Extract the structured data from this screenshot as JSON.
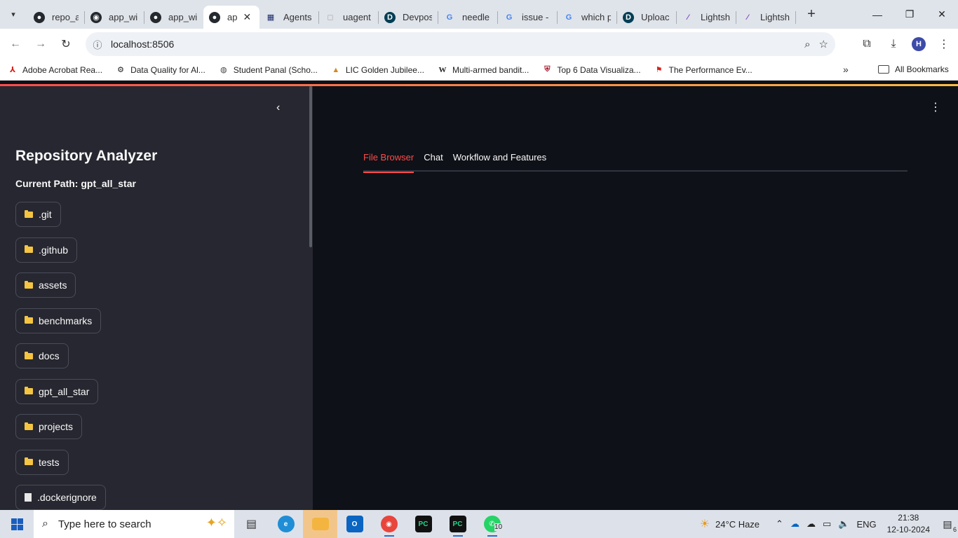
{
  "browser": {
    "tabs": [
      {
        "title": "repo_ar",
        "icon": "github-icon"
      },
      {
        "title": "app_wi",
        "icon": "streamlit-icon"
      },
      {
        "title": "app_wi",
        "icon": "github-icon"
      },
      {
        "title": "ap",
        "icon": "github-icon",
        "active": true
      },
      {
        "title": "Agents",
        "icon": "grid-app-icon"
      },
      {
        "title": "uagent",
        "icon": "cube-icon"
      },
      {
        "title": "Devpos",
        "icon": "devpost-icon"
      },
      {
        "title": "needle",
        "icon": "google-icon"
      },
      {
        "title": "issue -",
        "icon": "google-icon"
      },
      {
        "title": "which p",
        "icon": "google-icon"
      },
      {
        "title": "Uploac",
        "icon": "devpost-icon"
      },
      {
        "title": "Lightsh",
        "icon": "lightning-icon"
      },
      {
        "title": "Lightsh",
        "icon": "lightning-icon"
      }
    ],
    "url": "localhost:8506",
    "avatar_letter": "H",
    "bookmarks": [
      {
        "label": "Adobe Acrobat Rea...",
        "icon": "acrobat-icon"
      },
      {
        "label": "Data Quality for Al...",
        "icon": "data-quality-icon"
      },
      {
        "label": "Student Panal (Scho...",
        "icon": "globe-icon"
      },
      {
        "label": "LIC Golden Jubilee...",
        "icon": "graduation-icon"
      },
      {
        "label": "Multi-armed bandit...",
        "icon": "wikipedia-icon"
      },
      {
        "label": "Top 6 Data Visualiza...",
        "icon": "harvard-icon"
      },
      {
        "label": "The Performance Ev...",
        "icon": "red-bookmark-icon"
      }
    ],
    "all_bookmarks_label": "All Bookmarks"
  },
  "app": {
    "sidebar": {
      "title": "Repository Analyzer",
      "current_path": "Current Path: gpt_all_star",
      "items": [
        {
          "label": ".git",
          "type": "folder"
        },
        {
          "label": ".github",
          "type": "folder"
        },
        {
          "label": "assets",
          "type": "folder"
        },
        {
          "label": "benchmarks",
          "type": "folder"
        },
        {
          "label": "docs",
          "type": "folder"
        },
        {
          "label": "gpt_all_star",
          "type": "folder"
        },
        {
          "label": "projects",
          "type": "folder"
        },
        {
          "label": "tests",
          "type": "folder"
        },
        {
          "label": ".dockerignore",
          "type": "file"
        }
      ]
    },
    "tabs": [
      {
        "label": "File Browser",
        "active": true
      },
      {
        "label": "Chat"
      },
      {
        "label": "Workflow and Features"
      }
    ],
    "accent_color": "#ff4b4b"
  },
  "taskbar": {
    "search_placeholder": "Type here to search",
    "weather": "24°C  Haze",
    "language": "ENG",
    "time": "21:38",
    "date": "12-10-2024",
    "whatsapp_badge": "10",
    "notification_count": "6"
  }
}
